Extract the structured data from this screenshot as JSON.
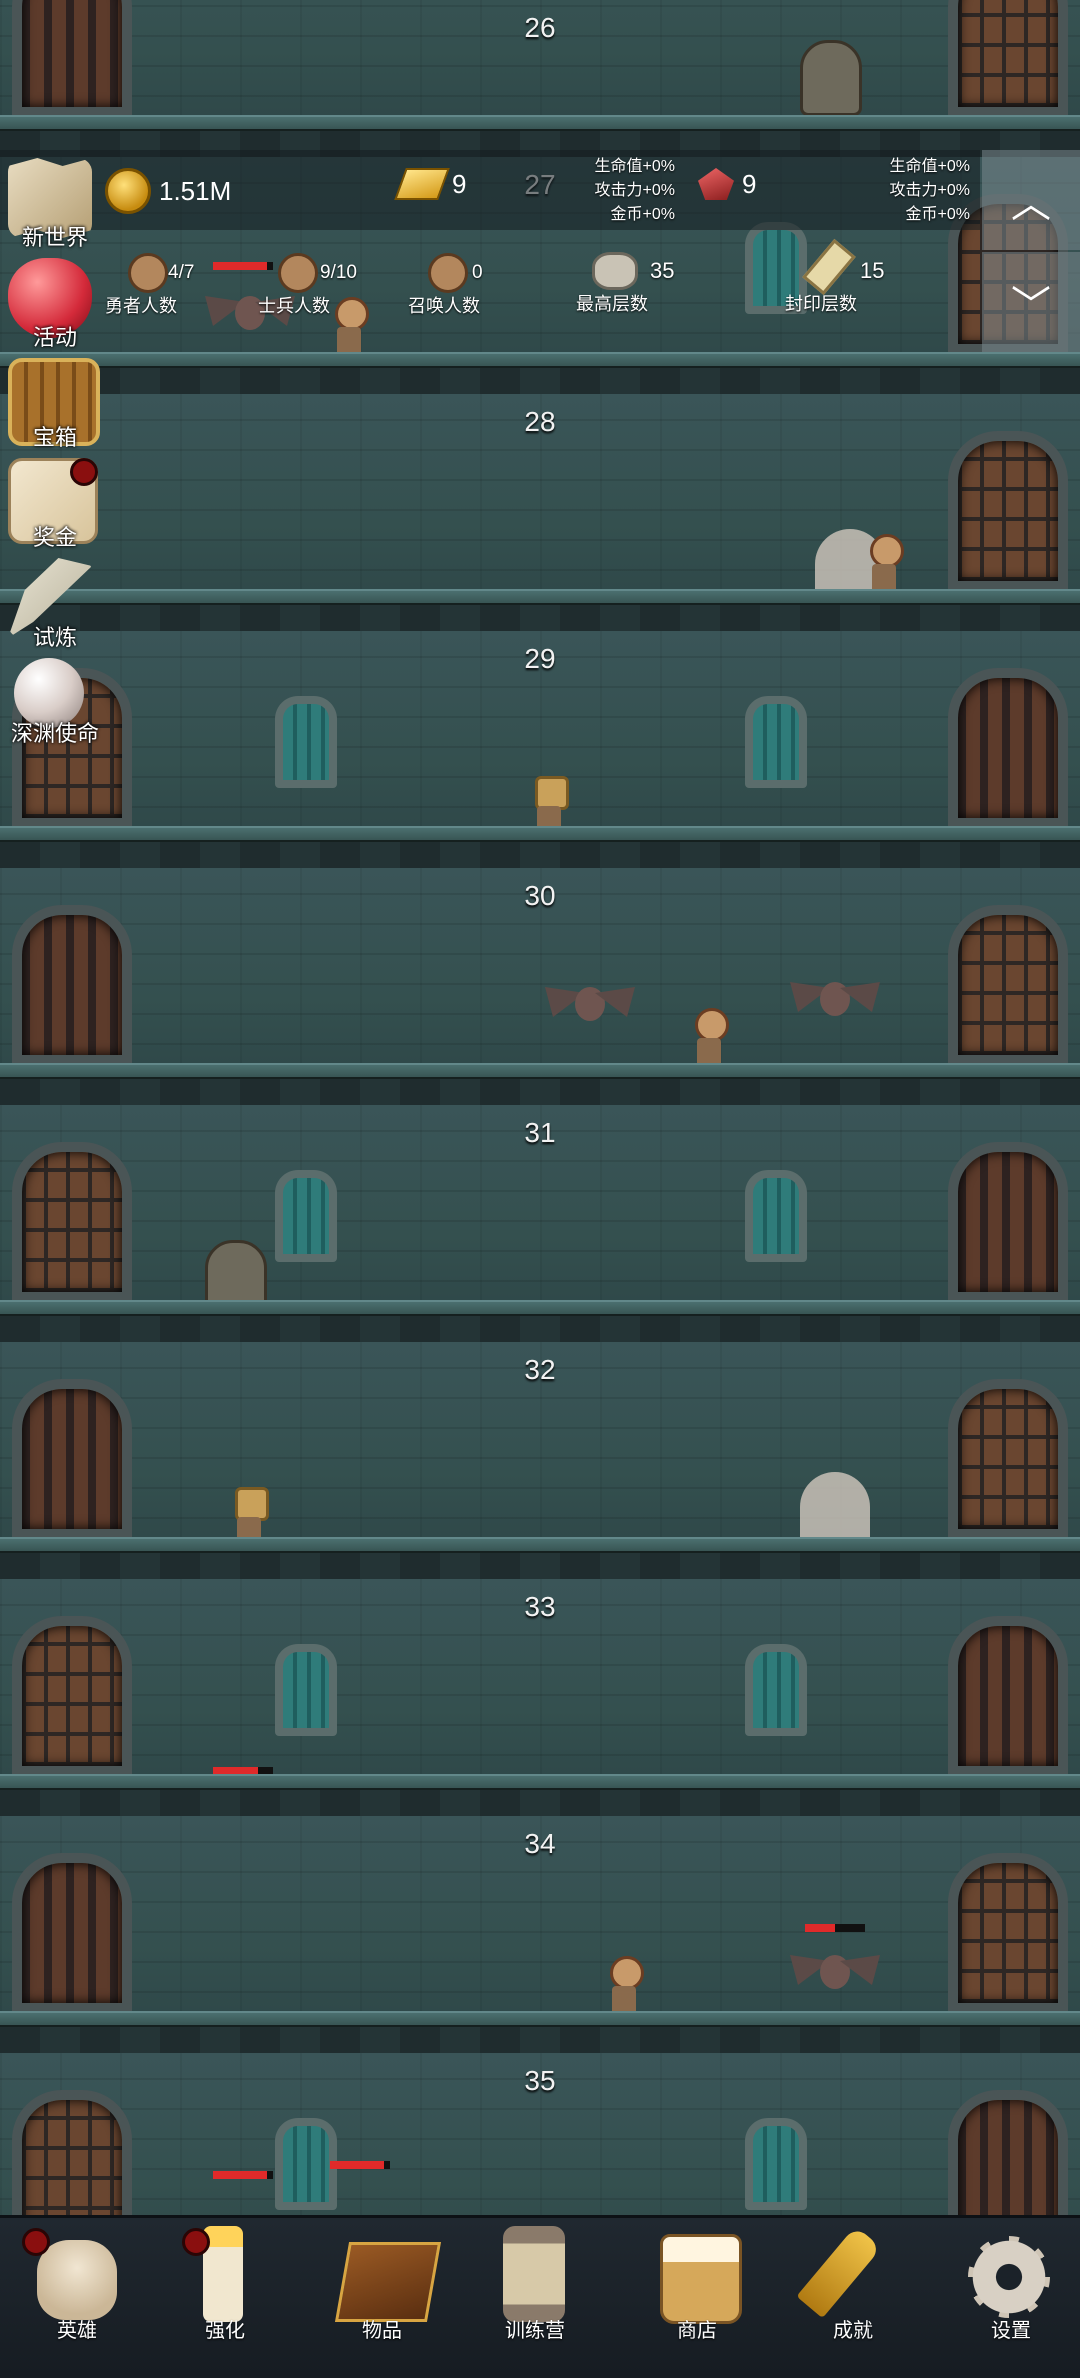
{
  "floors": [
    "26",
    "27",
    "28",
    "29",
    "30",
    "31",
    "32",
    "33",
    "34",
    "35"
  ],
  "resources": {
    "coins": "1.51M",
    "gold_bars": "9",
    "gold_bonus": [
      "生命值+0%",
      "攻击力+0%",
      "金币+0%"
    ],
    "gems": "9",
    "gem_bonus": [
      "生命值+0%",
      "攻击力+0%",
      "金币+0%"
    ]
  },
  "counts": {
    "heroes": {
      "value": "4/7",
      "label": "勇者人数"
    },
    "soldiers": {
      "value": "9/10",
      "label": "士兵人数"
    },
    "summons": {
      "value": "0",
      "label": "召唤人数"
    },
    "max_floor": {
      "value": "35",
      "label": "最高层数"
    },
    "sealed_floor": {
      "value": "15",
      "label": "封印层数"
    }
  },
  "scroll_buttons": {
    "up": "up-chevron-icon",
    "down": "down-chevron-icon"
  },
  "side_menu": [
    {
      "label": "新世界",
      "icon": "map-icon"
    },
    {
      "label": "活动",
      "icon": "heart-icon"
    },
    {
      "label": "宝箱",
      "icon": "chest-icon"
    },
    {
      "label": "奖金",
      "icon": "envelope-icon",
      "badge": true
    },
    {
      "label": "试炼",
      "icon": "feather-icon"
    },
    {
      "label": "深渊使命",
      "icon": "pearl-icon"
    }
  ],
  "bottom_nav": [
    {
      "label": "英雄",
      "icon": "skull-icon",
      "badge": true
    },
    {
      "label": "强化",
      "icon": "candle-icon",
      "badge": true
    },
    {
      "label": "物品",
      "icon": "book-icon"
    },
    {
      "label": "训练营",
      "icon": "lantern-icon"
    },
    {
      "label": "商店",
      "icon": "beer-mug-icon"
    },
    {
      "label": "成就",
      "icon": "key-icon"
    },
    {
      "label": "设置",
      "icon": "gear-icon"
    }
  ],
  "colors": {
    "hp_bar": "#e02a2a",
    "badge": "#8a0f0f",
    "nav_bg": "#1b2229"
  },
  "enemy_hp": {
    "floor27_bat": 0.9,
    "floor33_spider": 0.75,
    "floor34_bat": 0.5,
    "floor35_a": 0.9,
    "floor35_b": 0.9
  }
}
